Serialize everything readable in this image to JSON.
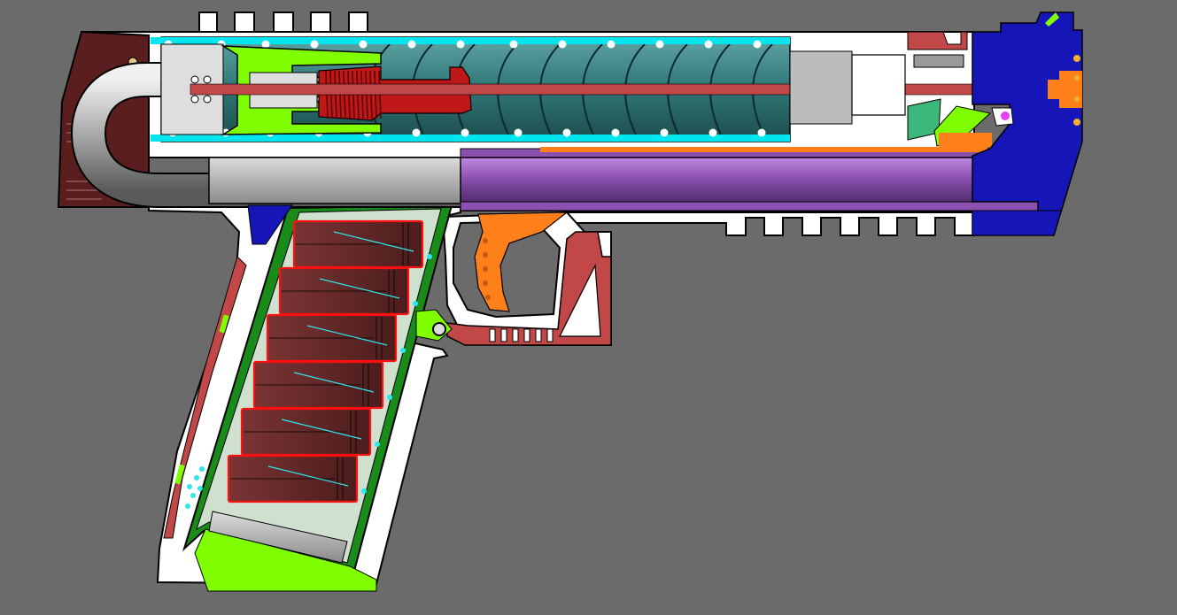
{
  "scene": {
    "view": "cutaway",
    "colors": {
      "background": "#6b6b6b",
      "frame": "#ffffff",
      "outline": "#000000",
      "cylinder_outline": "#00e5ee",
      "cylinder_fill": "#2e7575",
      "piston": "#88ff33",
      "rod": "#c24848",
      "grip_inner": "#1a8a1a",
      "magazine_cell": "#6e2c2c",
      "magazine_edge": "#ff1010",
      "barrel": "#8c50b0",
      "front_block": "#1616b8",
      "trigger": "#ff7f1a",
      "trigger_guard": "#c24848",
      "rear_block": "#5a1e1e",
      "lime": "#7fff00",
      "pipe": "#bdbdbd"
    }
  }
}
